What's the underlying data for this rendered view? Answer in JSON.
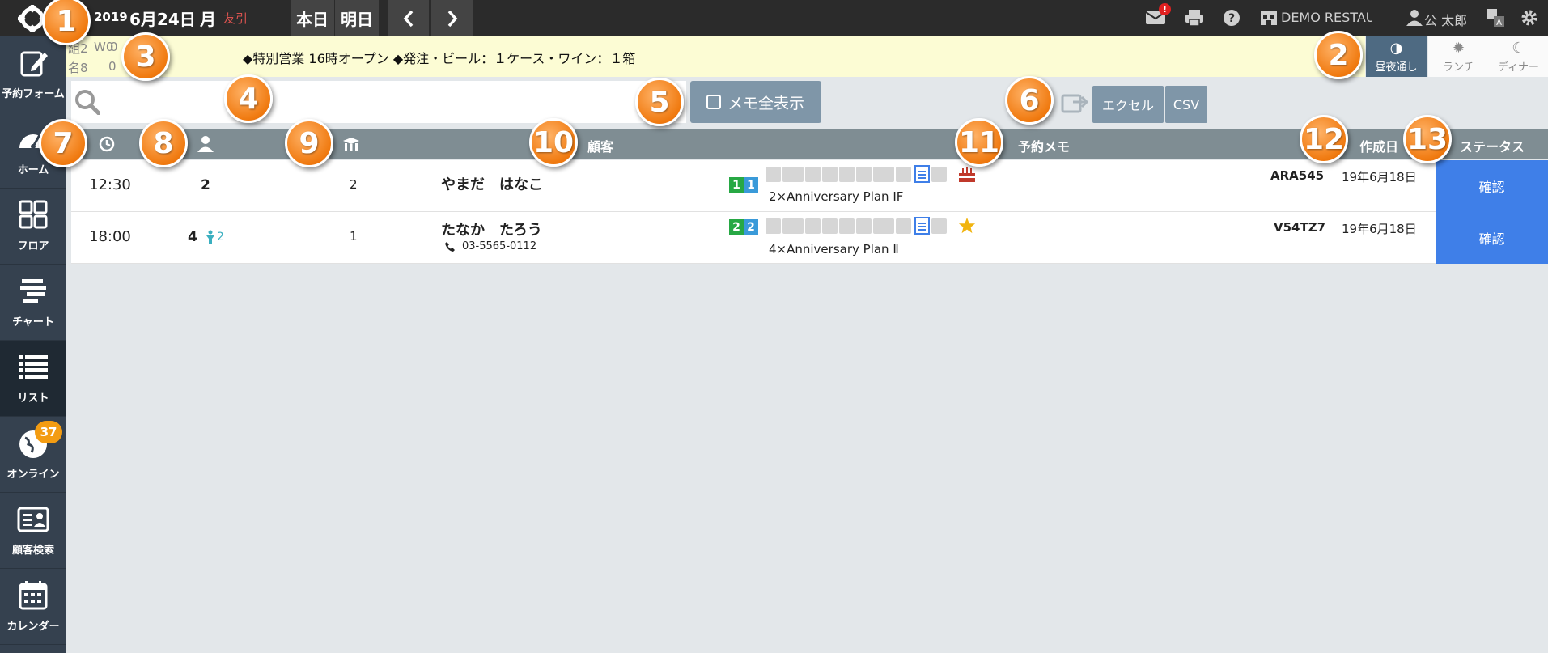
{
  "header": {
    "year": "2019",
    "month_day": "6月24日",
    "weekday": "月",
    "rokuyo": "友引",
    "today_label": "本日",
    "tomorrow_label": "明日",
    "restaurant": "DEMO RESTAURANT",
    "user": "公 太郎",
    "mail_badge": "!",
    "icons": [
      "mail-icon",
      "print-icon",
      "help-icon",
      "restaurant-icon",
      "user-icon",
      "translate-icon",
      "gear-icon"
    ]
  },
  "sidebar": {
    "items": [
      {
        "label": "予約フォーム",
        "icon": "edit-icon"
      },
      {
        "label": "ホーム",
        "icon": "dashboard-icon"
      },
      {
        "label": "フロア",
        "icon": "floor-icon"
      },
      {
        "label": "チャート",
        "icon": "chart-icon"
      },
      {
        "label": "リスト",
        "icon": "list-icon"
      },
      {
        "label": "オンライン",
        "icon": "globe-icon",
        "badge": "37"
      },
      {
        "label": "顧客検索",
        "icon": "customer-card-icon"
      },
      {
        "label": "カレンダー",
        "icon": "calendar-icon"
      }
    ]
  },
  "notice": {
    "counts_row1": [
      "組2",
      "W0",
      "0"
    ],
    "counts_row2": [
      "名8",
      "0"
    ],
    "text": "◆特別営業 16時オープン ◆発注・ビール：１ケース・ワイン：１箱"
  },
  "shifts": [
    {
      "label": "昼夜通し",
      "active": true
    },
    {
      "label": "ランチ",
      "active": false
    },
    {
      "label": "ディナー",
      "active": false
    }
  ],
  "toolbar": {
    "search_placeholder": "",
    "memo_toggle_label": "メモ全表示",
    "excel_label": "エクセル",
    "csv_label": "CSV"
  },
  "table": {
    "headers": {
      "customer": "顧客",
      "memo": "予約メモ",
      "created": "作成日",
      "status": "ステータス"
    },
    "rows": [
      {
        "time": "12:30",
        "party": "2",
        "kids": "",
        "seats": "2",
        "name": "やまだ　はなこ",
        "phone": "",
        "tags": [
          "1",
          "1"
        ],
        "plan": "2×Anniversary Plan ⅠF",
        "code": "ARA545",
        "created": "19年6月18日",
        "status": "確認",
        "special_icon": "cake-icon"
      },
      {
        "time": "18:00",
        "party": "4",
        "kids": "2",
        "seats": "1",
        "name": "たなか　たろう",
        "phone": "03-5565-0112",
        "tags": [
          "2",
          "2"
        ],
        "plan": "4×Anniversary Plan Ⅱ",
        "code": "V54TZ7",
        "created": "19年6月18日",
        "status": "確認",
        "special_icon": "star-icon"
      }
    ]
  },
  "callouts": [
    "1",
    "2",
    "3",
    "4",
    "5",
    "6",
    "7",
    "8",
    "9",
    "10",
    "11",
    "12",
    "13"
  ],
  "colors": {
    "accent": "#3f7fe8",
    "callout": "#f07a10",
    "sidebar": "#35414f",
    "notice": "#fcfcd4"
  }
}
